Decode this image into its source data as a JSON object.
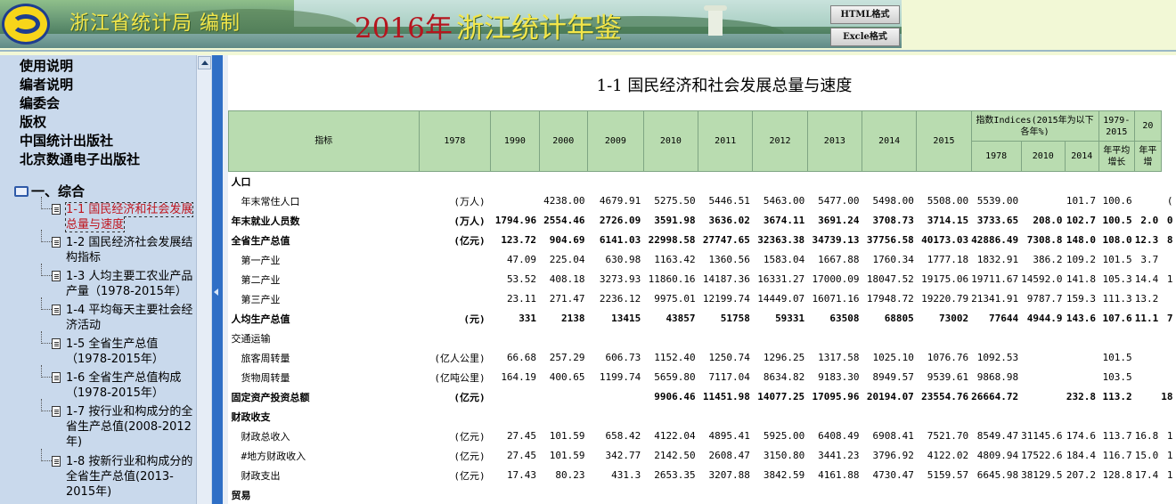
{
  "header": {
    "publisher": "浙江省统计局  编制",
    "year": "2016年",
    "title": "浙江统计年鉴",
    "btn_html": "HTML格式",
    "btn_excel": "Excle格式"
  },
  "sidebar": {
    "top_links": [
      "使用说明",
      "编者说明",
      "编委会",
      "版权",
      "中国统计出版社",
      "北京数通电子出版社"
    ],
    "section": "一、综合",
    "items": [
      {
        "label": "1-1  国民经济和社会发展总量与速度",
        "active": true
      },
      {
        "label": "1-2  国民经济社会发展结构指标"
      },
      {
        "label": "1-3  人均主要工农业产品产量（1978-2015年）"
      },
      {
        "label": "1-4  平均每天主要社会经济活动"
      },
      {
        "label": "1-5  全省生产总值（1978-2015年）"
      },
      {
        "label": "1-6  全省生产总值构成（1978-2015年）"
      },
      {
        "label": "1-7  按行业和构成分的全省生产总值(2008-2012年)"
      },
      {
        "label": "1-8  按新行业和构成分的全省生产总值(2013-2015年)"
      }
    ]
  },
  "main": {
    "title": "1-1  国民经济和社会发展总量与速度",
    "col_indicator": "指标",
    "years": [
      "1978",
      "1990",
      "2000",
      "2009",
      "2010",
      "2011",
      "2012",
      "2013",
      "2014",
      "2015"
    ],
    "index_header": "指数Indices(2015年为以下各年%)",
    "index_years": [
      "1978",
      "2010",
      "2014"
    ],
    "growth_header_top": "1979-2015",
    "growth_header_bottom": "年平均增长",
    "extra_header_top": "20",
    "extra_header_mid": "20",
    "extra_header_bottom": "年平增",
    "rows": [
      {
        "label": "人口",
        "unit": "",
        "bold": true,
        "cells": [
          "",
          "",
          "",
          "",
          "",
          "",
          "",
          "",
          "",
          "",
          "",
          "",
          "",
          "",
          ""
        ]
      },
      {
        "label": "年末常住人口",
        "unit": "(万人)",
        "indent": true,
        "cells": [
          "",
          "4238.00",
          "4679.91",
          "5275.50",
          "5446.51",
          "5463.00",
          "5477.00",
          "5498.00",
          "5508.00",
          "5539.00",
          "",
          "101.7",
          "100.6",
          "",
          "("
        ]
      },
      {
        "label": "年末就业人员数",
        "unit": "(万人)",
        "bold": true,
        "cells": [
          "1794.96",
          "2554.46",
          "2726.09",
          "3591.98",
          "3636.02",
          "3674.11",
          "3691.24",
          "3708.73",
          "3714.15",
          "3733.65",
          "208.0",
          "102.7",
          "100.5",
          "2.0",
          "0"
        ]
      },
      {
        "label": "全省生产总值",
        "unit": "(亿元)",
        "bold": true,
        "cells": [
          "123.72",
          "904.69",
          "6141.03",
          "22998.58",
          "27747.65",
          "32363.38",
          "34739.13",
          "37756.58",
          "40173.03",
          "42886.49",
          "7308.8",
          "148.0",
          "108.0",
          "12.3",
          "8"
        ]
      },
      {
        "label": "第一产业",
        "unit": "",
        "indent": true,
        "cells": [
          "47.09",
          "225.04",
          "630.98",
          "1163.42",
          "1360.56",
          "1583.04",
          "1667.88",
          "1760.34",
          "1777.18",
          "1832.91",
          "386.2",
          "109.2",
          "101.5",
          "3.7",
          ""
        ]
      },
      {
        "label": "第二产业",
        "unit": "",
        "indent": true,
        "cells": [
          "53.52",
          "408.18",
          "3273.93",
          "11860.16",
          "14187.36",
          "16331.27",
          "17000.09",
          "18047.52",
          "19175.06",
          "19711.67",
          "14592.0",
          "141.8",
          "105.3",
          "14.4",
          "1"
        ]
      },
      {
        "label": "第三产业",
        "unit": "",
        "indent": true,
        "cells": [
          "23.11",
          "271.47",
          "2236.12",
          "9975.01",
          "12199.74",
          "14449.07",
          "16071.16",
          "17948.72",
          "19220.79",
          "21341.91",
          "9787.7",
          "159.3",
          "111.3",
          "13.2",
          ""
        ]
      },
      {
        "label": "人均生产总值",
        "unit": "(元)",
        "bold": true,
        "cells": [
          "331",
          "2138",
          "13415",
          "43857",
          "51758",
          "59331",
          "63508",
          "68805",
          "73002",
          "77644",
          "4944.9",
          "143.6",
          "107.6",
          "11.1",
          "7"
        ]
      },
      {
        "label": "交通运输",
        "unit": "",
        "cells": [
          "",
          "",
          "",
          "",
          "",
          "",
          "",
          "",
          "",
          "",
          "",
          "",
          "",
          "",
          ""
        ]
      },
      {
        "label": "旅客周转量",
        "unit": "(亿人公里)",
        "indent": true,
        "cells": [
          "66.68",
          "257.29",
          "606.73",
          "1152.40",
          "1250.74",
          "1296.25",
          "1317.58",
          "1025.10",
          "1076.76",
          "1092.53",
          "",
          "",
          "101.5",
          "",
          ""
        ]
      },
      {
        "label": "货物周转量",
        "unit": "(亿吨公里)",
        "indent": true,
        "cells": [
          "164.19",
          "400.65",
          "1199.74",
          "5659.80",
          "7117.04",
          "8634.82",
          "9183.30",
          "8949.57",
          "9539.61",
          "9868.98",
          "",
          "",
          "103.5",
          "",
          ""
        ]
      },
      {
        "label": "固定资产投资总额",
        "unit": "(亿元)",
        "bold": true,
        "cells": [
          "",
          "",
          "",
          "9906.46",
          "11451.98",
          "14077.25",
          "17095.96",
          "20194.07",
          "23554.76",
          "26664.72",
          "",
          "232.8",
          "113.2",
          "",
          "18"
        ]
      },
      {
        "label": "财政收支",
        "unit": "",
        "bold": true,
        "cells": [
          "",
          "",
          "",
          "",
          "",
          "",
          "",
          "",
          "",
          "",
          "",
          "",
          "",
          "",
          ""
        ]
      },
      {
        "label": "财政总收入",
        "unit": "(亿元)",
        "indent": true,
        "cells": [
          "27.45",
          "101.59",
          "658.42",
          "4122.04",
          "4895.41",
          "5925.00",
          "6408.49",
          "6908.41",
          "7521.70",
          "8549.47",
          "31145.6",
          "174.6",
          "113.7",
          "16.8",
          "1"
        ]
      },
      {
        "label": "#地方财政收入",
        "unit": "(亿元)",
        "indent": true,
        "cells": [
          "27.45",
          "101.59",
          "342.77",
          "2142.50",
          "2608.47",
          "3150.80",
          "3441.23",
          "3796.92",
          "4122.02",
          "4809.94",
          "17522.6",
          "184.4",
          "116.7",
          "15.0",
          "1"
        ]
      },
      {
        "label": "财政支出",
        "unit": "(亿元)",
        "indent": true,
        "cells": [
          "17.43",
          "80.23",
          "431.3",
          "2653.35",
          "3207.88",
          "3842.59",
          "4161.88",
          "4730.47",
          "5159.57",
          "6645.98",
          "38129.5",
          "207.2",
          "128.8",
          "17.4",
          "1"
        ]
      },
      {
        "label": "贸易",
        "unit": "",
        "bold": true,
        "cells": [
          "",
          "",
          "",
          "",
          "",
          "",
          "",
          "",
          "",
          "",
          "",
          "",
          "",
          "",
          ""
        ]
      }
    ]
  }
}
